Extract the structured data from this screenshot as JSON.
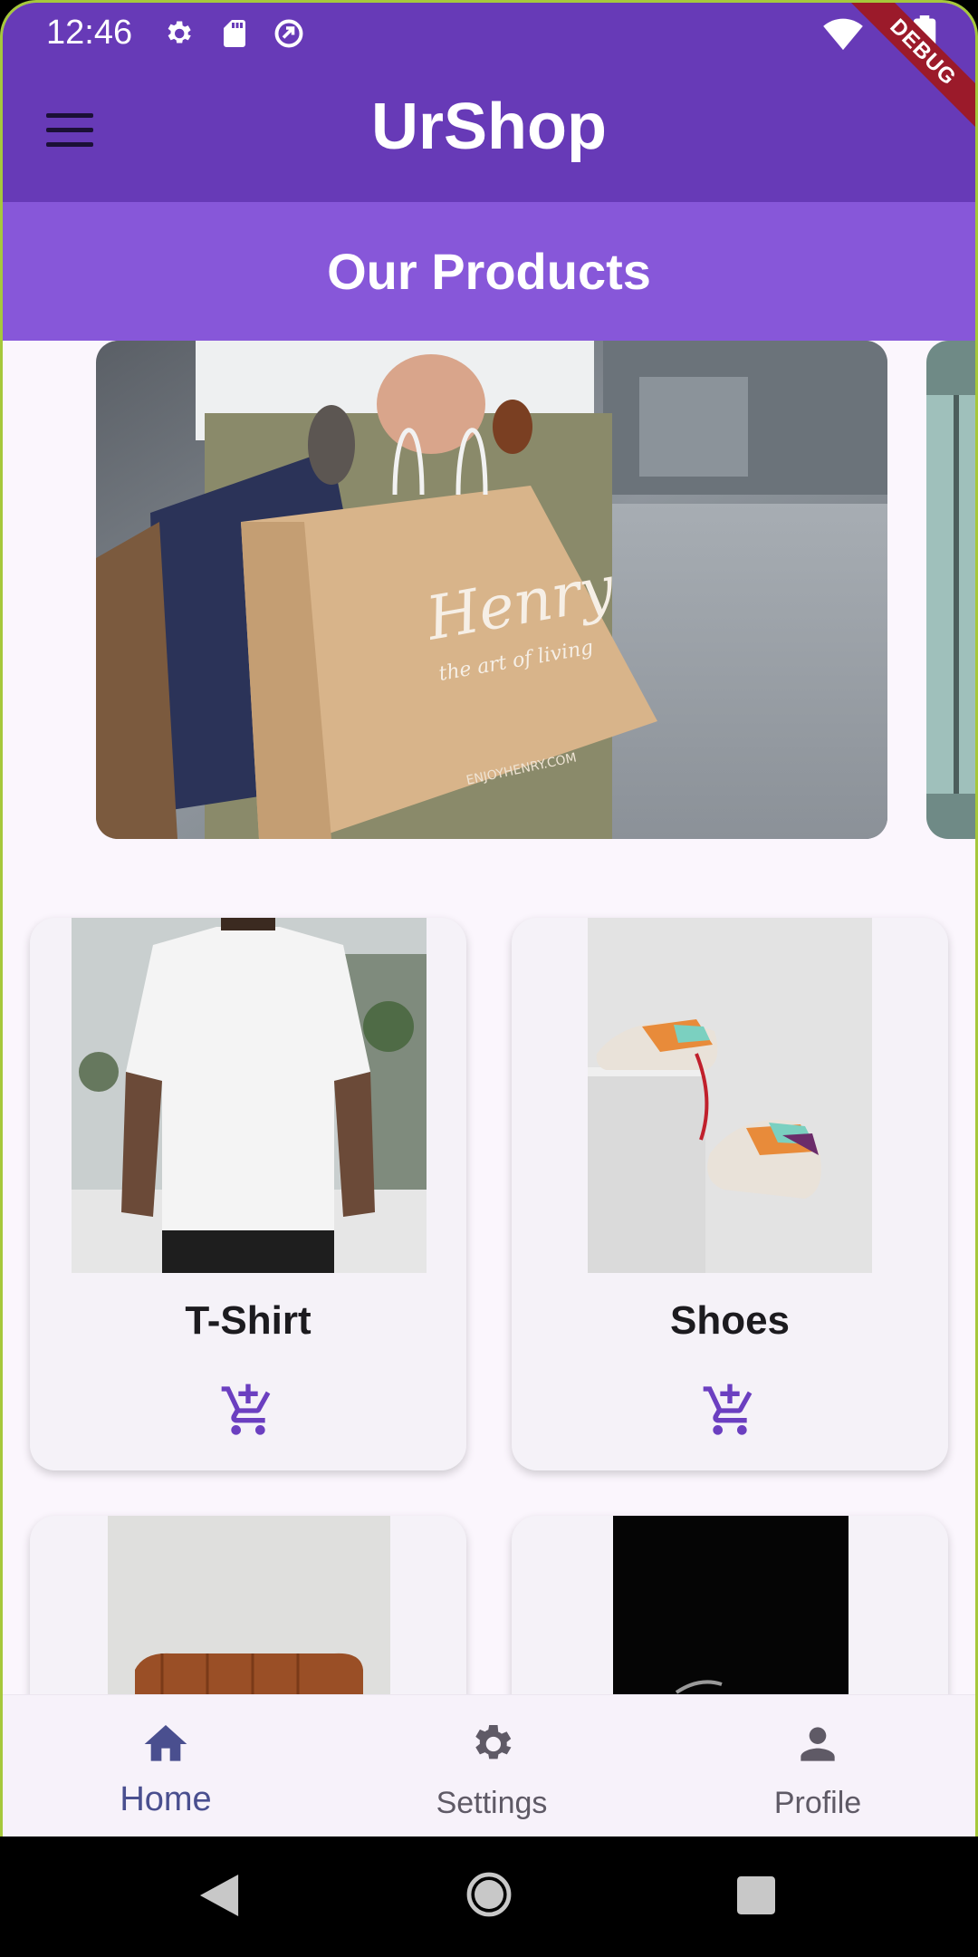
{
  "status_bar": {
    "time": "12:46",
    "left_icons": [
      "settings-icon",
      "sd-card-icon",
      "sync-icon"
    ],
    "right_icons": [
      "wifi-icon",
      "battery-icon"
    ]
  },
  "debug_banner": "DEBUG",
  "app_bar": {
    "title": "UrShop",
    "menu_icon": "menu-icon"
  },
  "section_title": "Our Products",
  "carousel": {
    "slides": [
      "shopping-bags-photo",
      "storefront-photo"
    ],
    "bag_brand": "Henry",
    "bag_tagline": "the art of living",
    "bag_site": "ENJOYHENRY.COM"
  },
  "products": [
    {
      "name": "T-Shirt",
      "action_icon": "add-to-cart-icon"
    },
    {
      "name": "Shoes",
      "action_icon": "add-to-cart-icon"
    },
    {
      "name": "",
      "action_icon": ""
    },
    {
      "name": "",
      "action_icon": ""
    }
  ],
  "bottom_nav": {
    "items": [
      {
        "label": "Home",
        "icon": "home-icon",
        "active": true
      },
      {
        "label": "Settings",
        "icon": "settings-icon",
        "active": false
      },
      {
        "label": "Profile",
        "icon": "person-icon",
        "active": false
      }
    ]
  },
  "colors": {
    "primary": "#673ab7",
    "subheader": "#8757d9",
    "accent_icon": "#6b3fc0",
    "nav_active": "#4a4f8f"
  }
}
